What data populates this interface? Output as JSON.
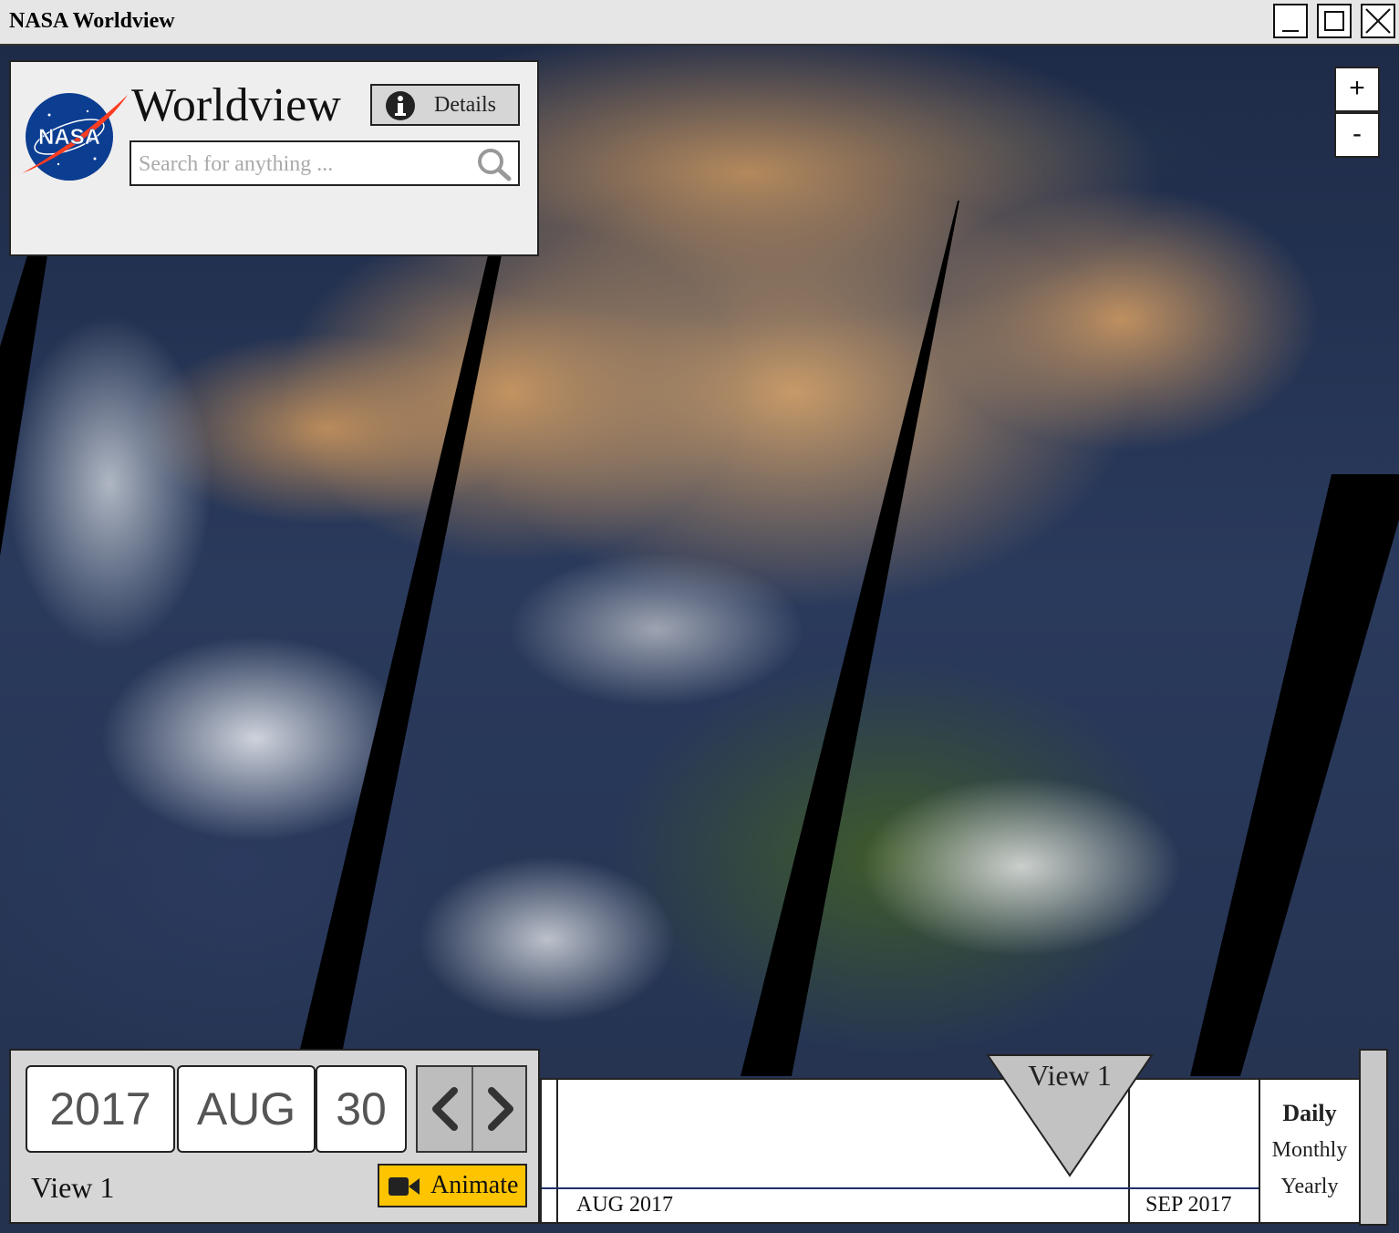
{
  "window": {
    "title": "NASA Worldview"
  },
  "header": {
    "brand": "Worldview",
    "details_label": "Details",
    "search_placeholder": "Search for anything ..."
  },
  "zoom": {
    "in_label": "+",
    "out_label": "-"
  },
  "date": {
    "year": "2017",
    "month": "AUG",
    "day": "30"
  },
  "view_label": "View 1",
  "animate_label": "Animate",
  "timeline": {
    "marker_label": "View 1",
    "months": [
      "AUG 2017",
      "SEP 2017"
    ]
  },
  "periods": {
    "daily": "Daily",
    "monthly": "Monthly",
    "yearly": "Yearly",
    "selected": "Daily"
  },
  "colors": {
    "animate": "#ffc400",
    "nasa_blue": "#0b3d91",
    "nasa_red": "#fc3d21"
  }
}
